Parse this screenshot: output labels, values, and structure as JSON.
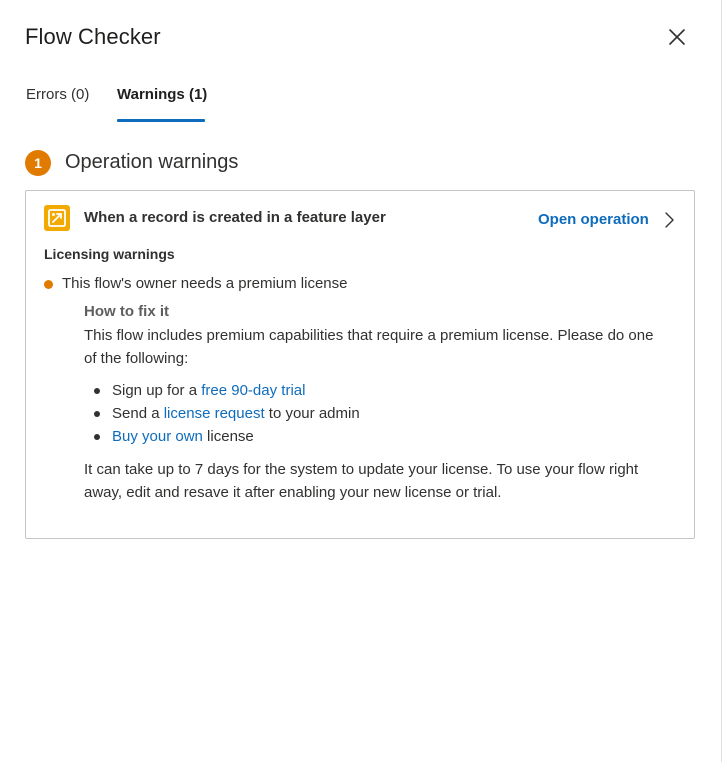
{
  "panel": {
    "title": "Flow Checker"
  },
  "tabs": {
    "errors_label": "Errors (0)",
    "warnings_label": "Warnings (1)"
  },
  "section": {
    "badge_count": "1",
    "title": "Operation warnings"
  },
  "operation": {
    "title": "When a record is created in a feature layer",
    "open_label": "Open operation",
    "icon": "arcgis-connector-icon",
    "icon_color": "#f2a900"
  },
  "licensing": {
    "heading": "Licensing warnings",
    "warning": "This flow's owner needs a premium license",
    "fix_heading": "How to fix it",
    "fix_description": "This flow includes premium capabilities that require a premium license. Please do one of the following:",
    "options": [
      {
        "before": "Sign up for a ",
        "link": "free 90-day trial",
        "after": ""
      },
      {
        "before": "Send a ",
        "link": "license request",
        "after": " to your admin"
      },
      {
        "before": "",
        "link": "Buy your own",
        "after": " license"
      }
    ],
    "footer": "It can take up to 7 days for the system to update your license. To use your flow right away, edit and resave it after enabling your new license or trial."
  },
  "colors": {
    "accent": "#0f6cbd",
    "warning": "#e07b00"
  }
}
